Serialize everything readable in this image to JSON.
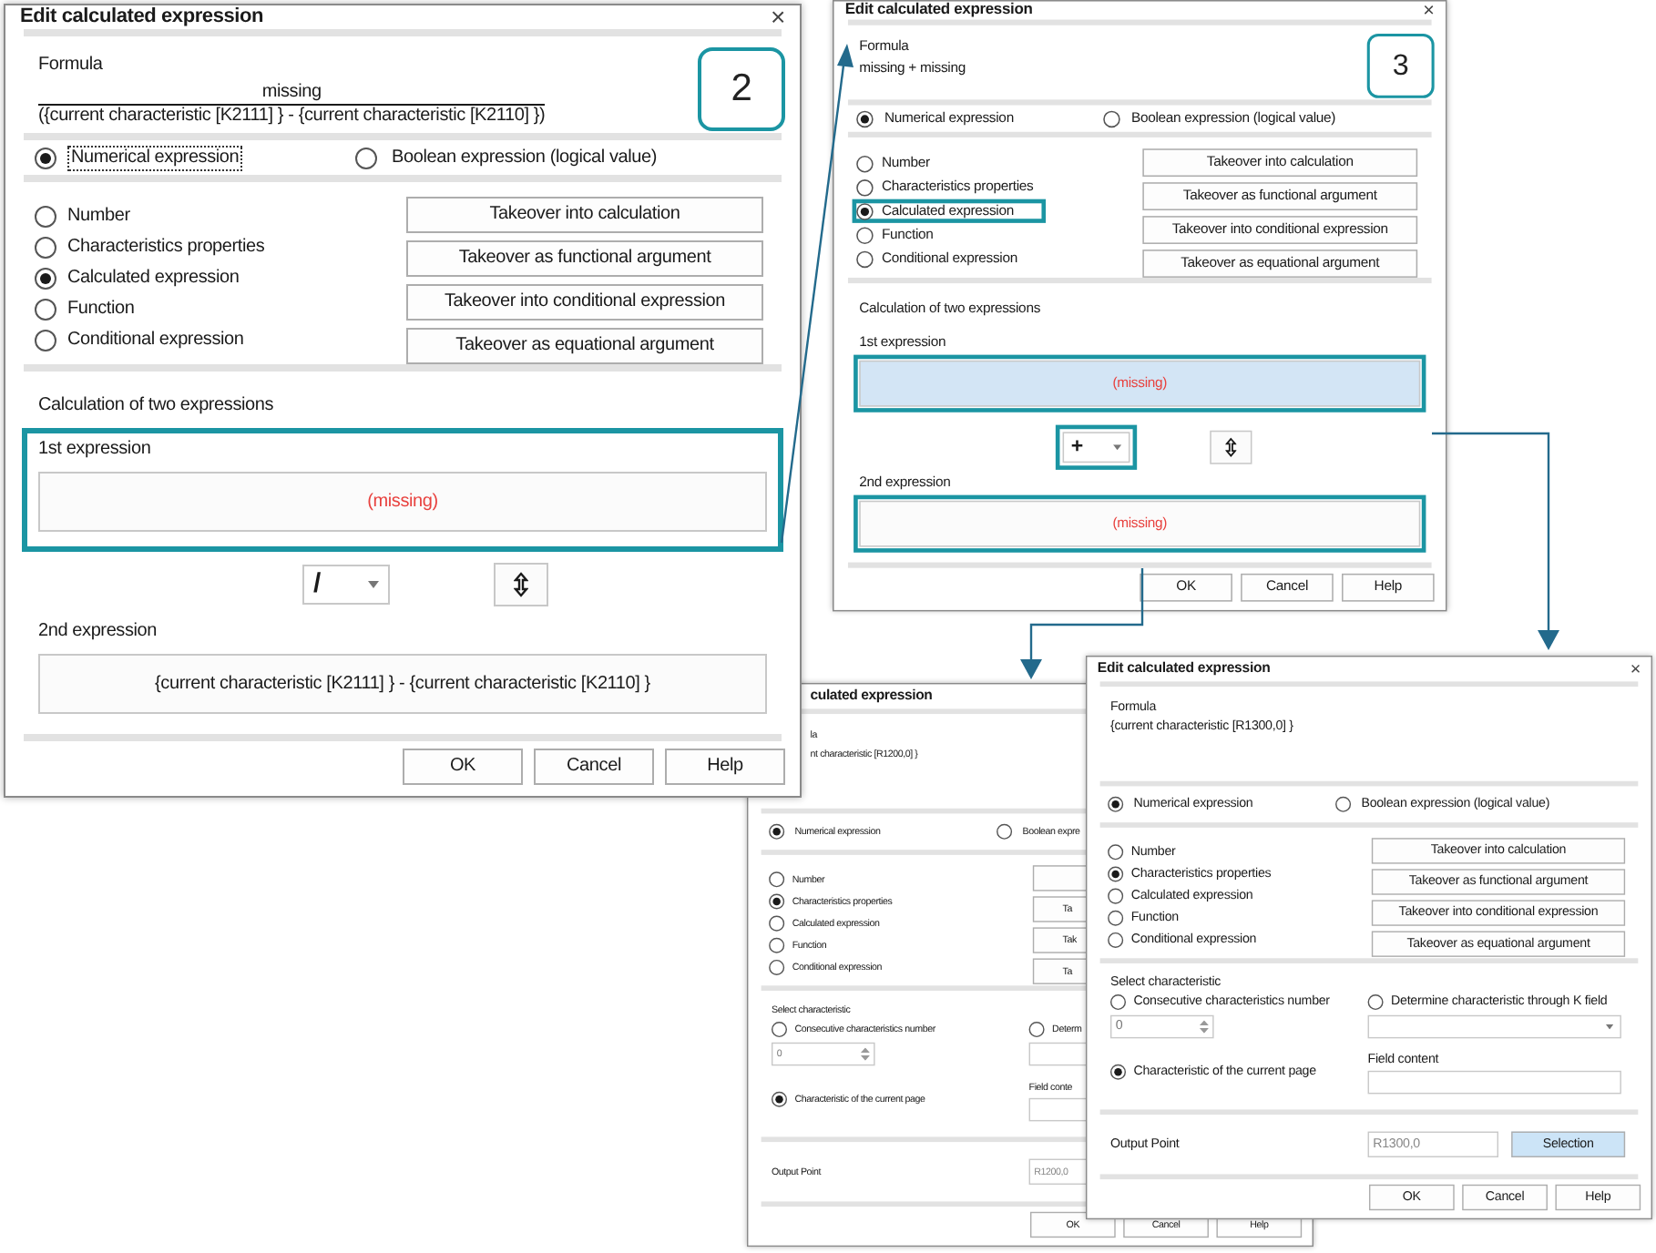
{
  "windows": [
    {
      "kind": "calculation",
      "title": "Edit calculated expression",
      "close": "×",
      "formula_label": "Formula",
      "formula": {
        "kind": "fraction",
        "numerator": "missing",
        "denominator": "({current characteristic [K2111] } - {current characteristic [K2110] })"
      },
      "step": "2",
      "expression_types": [
        {
          "label": "Numerical expression",
          "selected": true,
          "focused": true
        },
        {
          "label": "Boolean expression (logical value)",
          "selected": false,
          "focused": false
        }
      ],
      "sources": [
        {
          "label": "Number",
          "selected": false,
          "highlighted": false
        },
        {
          "label": "Characteristics properties",
          "selected": false,
          "highlighted": false
        },
        {
          "label": "Calculated expression",
          "selected": true,
          "highlighted": false
        },
        {
          "label": "Function",
          "selected": false,
          "highlighted": false
        },
        {
          "label": "Conditional expression",
          "selected": false,
          "highlighted": false
        }
      ],
      "takeover_buttons": [
        {
          "label": "Takeover into calculation"
        },
        {
          "label": "Takeover as functional argument"
        },
        {
          "label": "Takeover into conditional expression"
        },
        {
          "label": "Takeover as equational argument"
        }
      ],
      "calculation": {
        "title": "Calculation of two expressions",
        "first": {
          "label": "1st expression",
          "value": "(missing)",
          "missing": true,
          "selected": false,
          "group_highlighted": true,
          "field_highlighted": false
        },
        "operator": {
          "value": "/",
          "highlighted": false
        },
        "second": {
          "label": "2nd expression",
          "value": "{current characteristic [K2111] } - {current characteristic [K2110] }",
          "missing": false,
          "selected": false,
          "group_highlighted": false,
          "field_highlighted": false
        }
      },
      "buttons": [
        "OK",
        "Cancel",
        "Help"
      ]
    },
    {
      "kind": "calculation",
      "title": "Edit calculated expression",
      "close": "×",
      "formula_label": "Formula",
      "formula": {
        "kind": "plain",
        "text": "missing + missing"
      },
      "step": "3",
      "expression_types": [
        {
          "label": "Numerical expression",
          "selected": true,
          "focused": false
        },
        {
          "label": "Boolean expression (logical value)",
          "selected": false,
          "focused": false
        }
      ],
      "sources": [
        {
          "label": "Number",
          "selected": false,
          "highlighted": false
        },
        {
          "label": "Characteristics properties",
          "selected": false,
          "highlighted": false
        },
        {
          "label": "Calculated expression",
          "selected": true,
          "highlighted": true
        },
        {
          "label": "Function",
          "selected": false,
          "highlighted": false
        },
        {
          "label": "Conditional expression",
          "selected": false,
          "highlighted": false
        }
      ],
      "takeover_buttons": [
        {
          "label": "Takeover into calculation"
        },
        {
          "label": "Takeover as functional argument"
        },
        {
          "label": "Takeover into conditional expression"
        },
        {
          "label": "Takeover as equational argument"
        }
      ],
      "calculation": {
        "title": "Calculation of two expressions",
        "first": {
          "label": "1st expression",
          "value": "(missing)",
          "missing": true,
          "selected": true,
          "group_highlighted": false,
          "field_highlighted": true
        },
        "operator": {
          "value": "+",
          "highlighted": true
        },
        "second": {
          "label": "2nd expression",
          "value": "(missing)",
          "missing": true,
          "selected": false,
          "group_highlighted": false,
          "field_highlighted": true
        }
      },
      "buttons": [
        "OK",
        "Cancel",
        "Help"
      ]
    },
    {
      "kind": "characteristic",
      "title": "culated expression",
      "formula_label": "la",
      "formula": {
        "kind": "plain",
        "text": "nt characteristic [R1200,0] }"
      },
      "expression_types": [
        {
          "label": "Numerical expression",
          "selected": true,
          "focused": false
        },
        {
          "label": "Boolean expre",
          "selected": false,
          "focused": false
        }
      ],
      "sources": [
        {
          "label": "Number",
          "selected": false,
          "highlighted": false
        },
        {
          "label": "Characteristics properties",
          "selected": true,
          "highlighted": false
        },
        {
          "label": "Calculated expression",
          "selected": false,
          "highlighted": false
        },
        {
          "label": "Function",
          "selected": false,
          "highlighted": false
        },
        {
          "label": "Conditional expression",
          "selected": false,
          "highlighted": false
        }
      ],
      "takeover_buttons": [
        {
          "kind": "blank"
        },
        {
          "kind": "labeled",
          "label": "Ta"
        },
        {
          "kind": "labeled",
          "label": "Tak"
        },
        {
          "kind": "labeled",
          "label": "Ta"
        }
      ],
      "characteristic": {
        "title": "Select characteristic",
        "consecutive": {
          "label": "Consecutive characteristics number",
          "selected": false
        },
        "number_value": "0",
        "k_field": {
          "label": "Determ",
          "selected": false
        },
        "field_content_label": "Field conte",
        "current_page": {
          "label": "Characteristic of the current page",
          "selected": true
        }
      },
      "output": {
        "label": "Output Point",
        "value": "R1200,0",
        "disabled": true
      },
      "buttons": [
        "OK",
        "Cancel",
        "Help"
      ]
    },
    {
      "kind": "characteristic",
      "title": "Edit calculated expression",
      "close": "×",
      "formula_label": "Formula",
      "formula": {
        "kind": "plain",
        "text": "{current characteristic [R1300,0] }"
      },
      "expression_types": [
        {
          "label": "Numerical expression",
          "selected": true,
          "focused": false
        },
        {
          "label": "Boolean expression (logical value)",
          "selected": false,
          "focused": false
        }
      ],
      "sources": [
        {
          "label": "Number",
          "selected": false,
          "highlighted": false
        },
        {
          "label": "Characteristics properties",
          "selected": true,
          "highlighted": false
        },
        {
          "label": "Calculated expression",
          "selected": false,
          "highlighted": false
        },
        {
          "label": "Function",
          "selected": false,
          "highlighted": false
        },
        {
          "label": "Conditional expression",
          "selected": false,
          "highlighted": false
        }
      ],
      "takeover_buttons": [
        {
          "label": "Takeover into calculation"
        },
        {
          "label": "Takeover as functional argument"
        },
        {
          "label": "Takeover into conditional expression"
        },
        {
          "label": "Takeover as equational argument"
        }
      ],
      "characteristic": {
        "title": "Select characteristic",
        "consecutive": {
          "label": "Consecutive characteristics number",
          "selected": false
        },
        "number_value": "0",
        "k_field": {
          "label": "Determine characteristic through K field",
          "selected": false
        },
        "field_content_label": "Field content",
        "current_page": {
          "label": "Characteristic of the current page",
          "selected": true
        }
      },
      "output": {
        "label": "Output Point",
        "value": "R1300,0",
        "disabled": true,
        "selection": {
          "label": "Selection",
          "selected": true
        }
      },
      "buttons": [
        "OK",
        "Cancel",
        "Help"
      ]
    }
  ]
}
